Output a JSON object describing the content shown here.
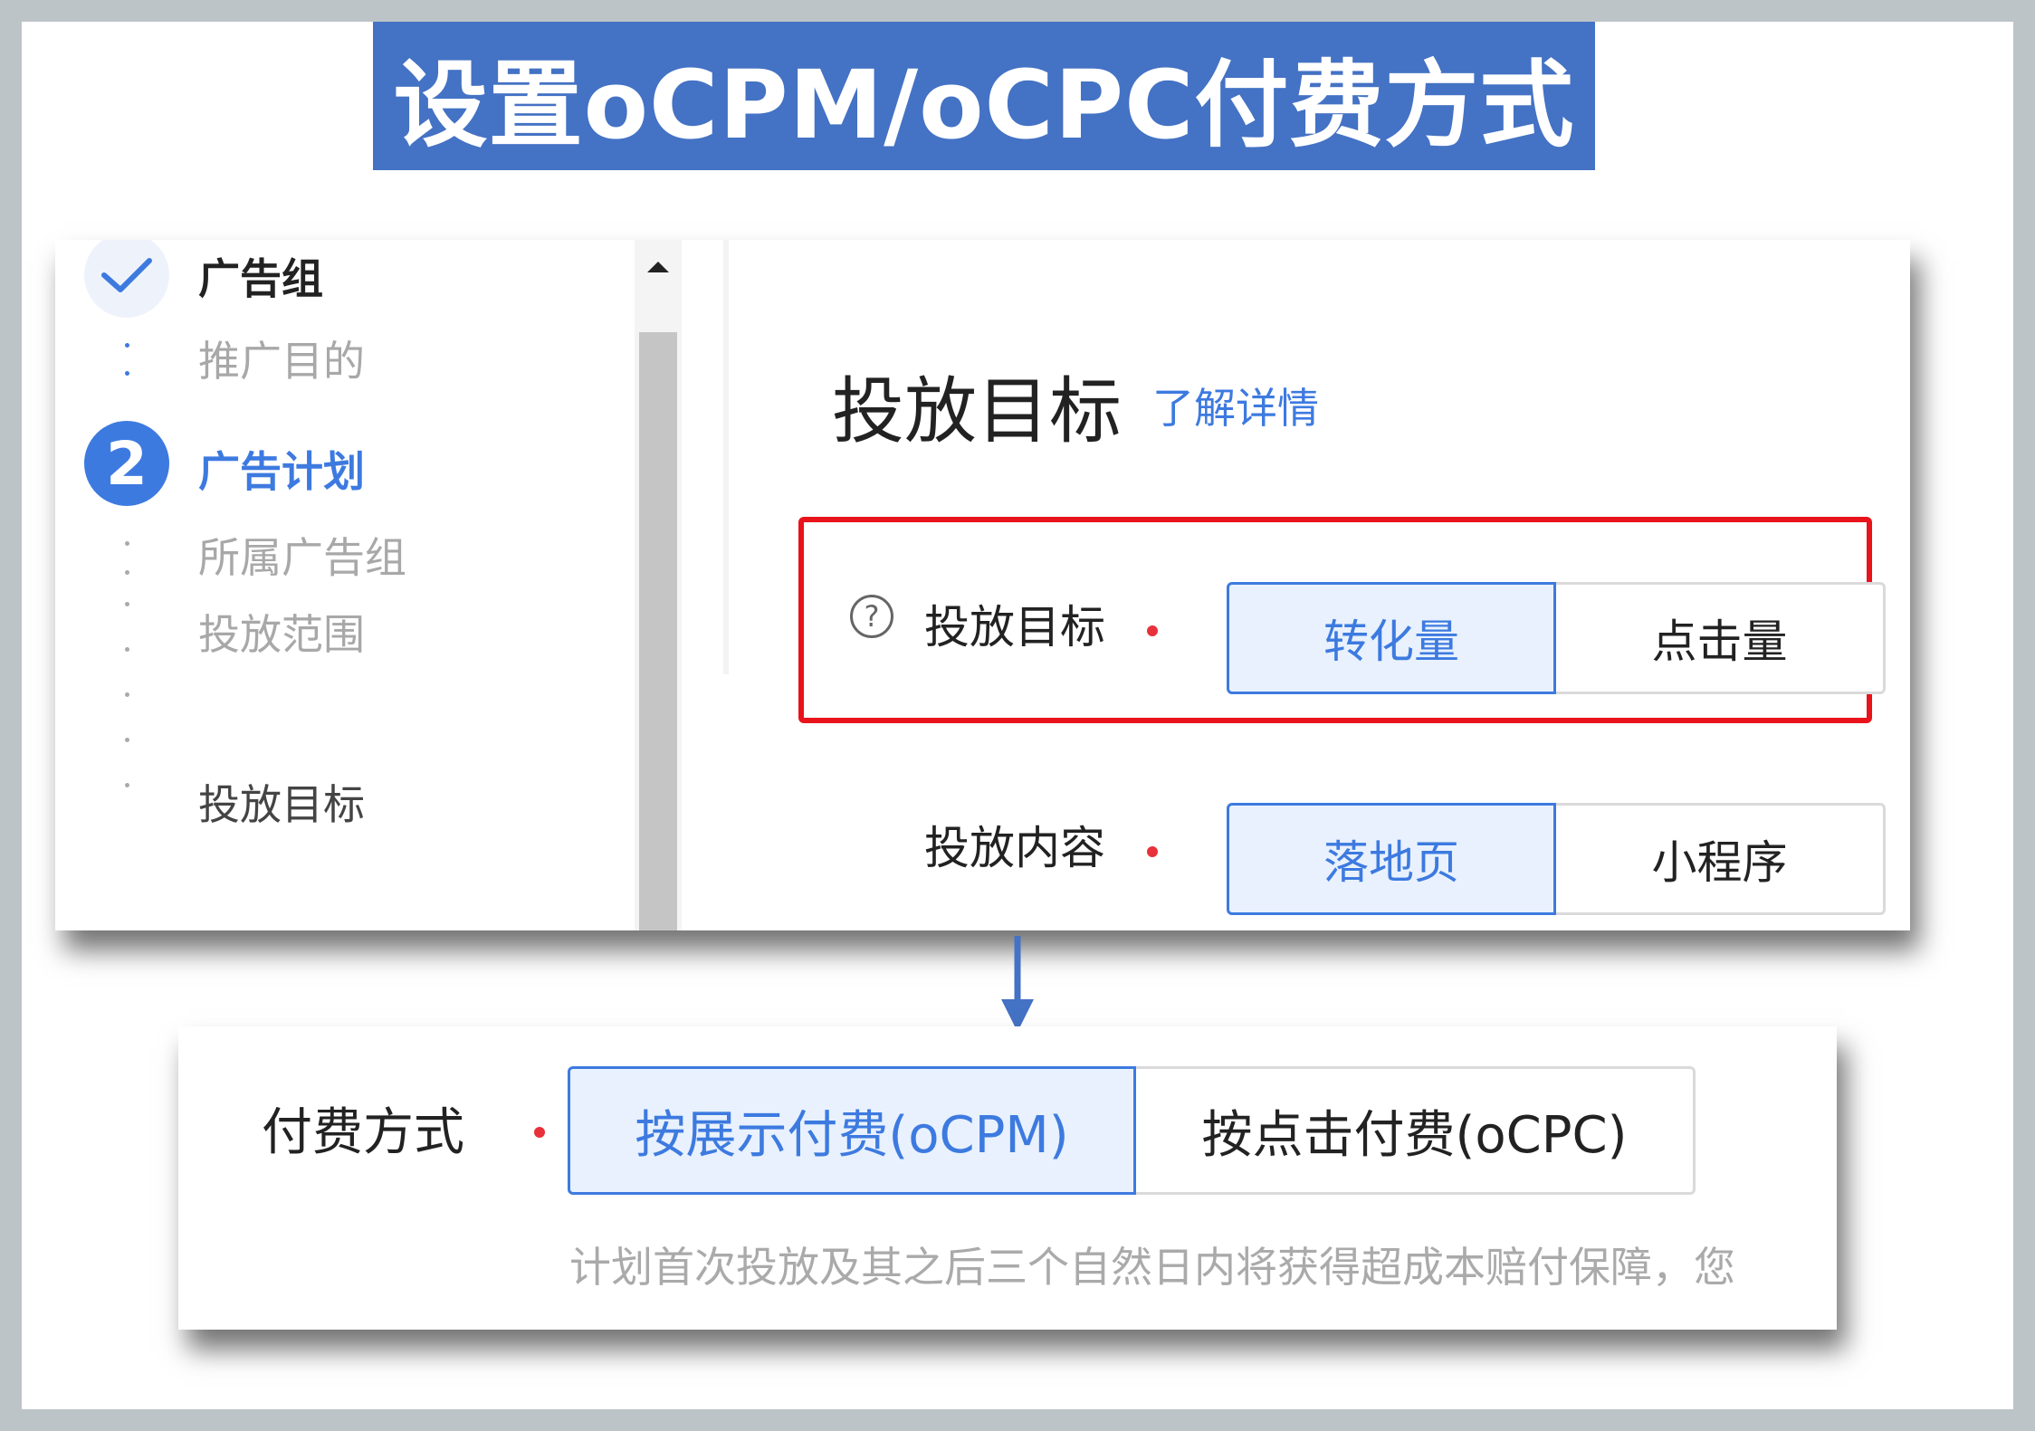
{
  "title": "设置oCPM/oCPC付费方式",
  "sidebar": {
    "steps": [
      {
        "label": "广告组",
        "state": "done",
        "icon": "check-icon"
      },
      {
        "label": "推广目的",
        "state": "sub-muted"
      },
      {
        "label": "广告计划",
        "state": "active",
        "number": "2"
      },
      {
        "label": "所属广告组",
        "state": "sub-muted"
      },
      {
        "label": "投放范围",
        "state": "sub-muted"
      },
      {
        "label": "投放目标",
        "state": "sub-current"
      }
    ]
  },
  "content": {
    "heading": "投放目标",
    "learn_more": "了解详情",
    "target_field": {
      "label": "投放目标",
      "help_icon": "?",
      "options": [
        "转化量",
        "点击量"
      ],
      "selected": "转化量"
    },
    "content_field": {
      "label": "投放内容",
      "options": [
        "落地页",
        "小程序"
      ],
      "selected": "落地页"
    }
  },
  "payment": {
    "label": "付费方式",
    "options": [
      "按展示付费(oCPM)",
      "按点击付费(oCPC)"
    ],
    "selected": "按展示付费(oCPM)",
    "note": "计划首次投放及其之后三个自然日内将获得超成本赔付保障，您"
  },
  "colors": {
    "banner": "#4472c4",
    "accent": "#3d7ae0",
    "highlight": "#e8131b",
    "required": "#e8313a"
  }
}
